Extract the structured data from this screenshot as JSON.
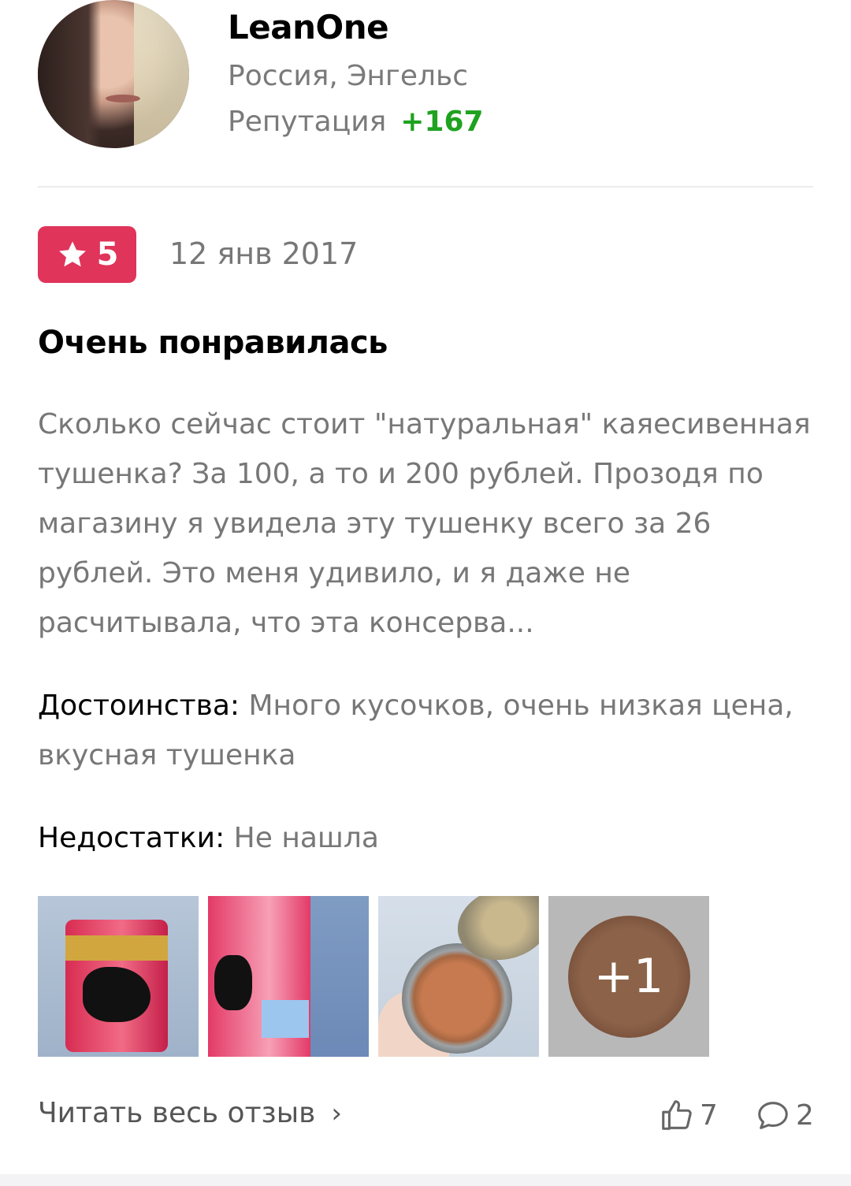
{
  "user": {
    "name": "LeanOne",
    "location": "Россия, Энгельс",
    "reputation_label": "Репутация",
    "reputation_value": "+167"
  },
  "review": {
    "rating": "5",
    "date": "12 янв 2017",
    "title": "Очень понравилась",
    "text": "Сколько сейчас стоит \"натуральная\" каяесивенная тушенка? За 100, а то и 200 рублей. Прозодя по магазину я увидела эту тушенку всего за 26 рублей. Это меня удивило, и я даже не расчитывала, что эта консерва...",
    "pros_label": "Достоинства:",
    "pros": "Много кусочков, очень низкая цена, вкусная тушенка",
    "cons_label": "Недостатки:",
    "cons": "Не нашла",
    "photos_more": "+1"
  },
  "footer": {
    "read_more": "Читать весь отзыв",
    "likes": "7",
    "comments": "2"
  },
  "colors": {
    "rating_badge": "#e0345a",
    "reputation_positive": "#1fa21f"
  }
}
